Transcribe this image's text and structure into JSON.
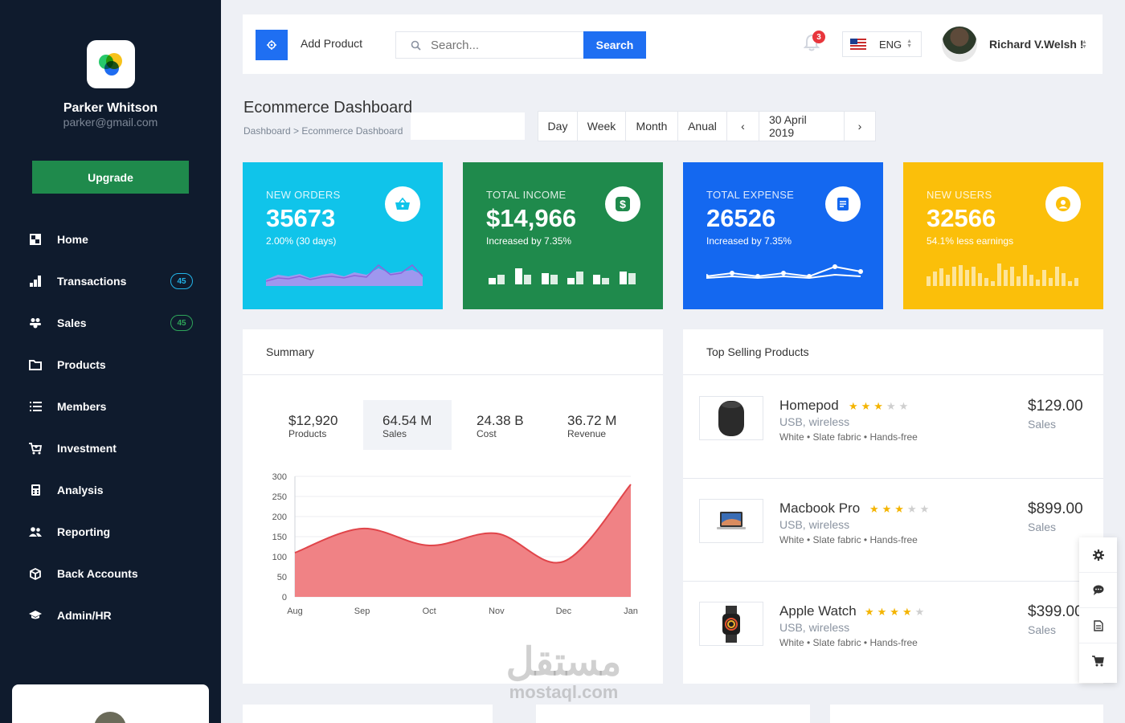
{
  "sidebar": {
    "user_name": "Parker Whitson",
    "user_email": "parker@gmail.com",
    "upgrade_label": "Upgrade",
    "items": [
      {
        "label": "Home",
        "icon": "home-icon"
      },
      {
        "label": "Transactions",
        "icon": "bar-chart-icon",
        "badge": "45"
      },
      {
        "label": "Sales",
        "icon": "users-icon",
        "badge": "45"
      },
      {
        "label": "Products",
        "icon": "folder-icon"
      },
      {
        "label": "Members",
        "icon": "list-icon"
      },
      {
        "label": "Investment",
        "icon": "cart-icon"
      },
      {
        "label": "Analysis",
        "icon": "calculator-icon"
      },
      {
        "label": "Reporting",
        "icon": "people-icon"
      },
      {
        "label": "Back Accounts",
        "icon": "cube-icon"
      },
      {
        "label": "Admin/HR",
        "icon": "graduation-icon"
      }
    ]
  },
  "topbar": {
    "add_label": "Add Product",
    "search_placeholder": "Search...",
    "search_button": "Search",
    "notification_count": "3",
    "language": "ENG",
    "profile_name": "Richard V.Welsh !"
  },
  "header": {
    "title": "Ecommerce Dashboard",
    "breadcrumb": "Dashboard > Ecommerce Dashboard",
    "ranges": [
      "Day",
      "Week",
      "Month",
      "Anual"
    ],
    "prev": "‹",
    "date": "30 April 2019",
    "next": "›"
  },
  "stats": [
    {
      "title": "NEW ORDERS",
      "value": "35673",
      "sub": "2.00% (30 days)",
      "color": "#10c4ea"
    },
    {
      "title": "TOTAL INCOME",
      "value": "$14,966",
      "sub": "Increased by 7.35%",
      "color": "#1f8a4c"
    },
    {
      "title": "TOTAL EXPENSE",
      "value": "26526",
      "sub": "Increased by 7.35%",
      "color": "#1468f0"
    },
    {
      "title": "NEW USERS",
      "value": "32566",
      "sub": "54.1% less earnings",
      "color": "#fbbf0a"
    }
  ],
  "summary": {
    "title": "Summary",
    "metrics": [
      {
        "value": "$12,920",
        "label": "Products"
      },
      {
        "value": "64.54 M",
        "label": "Sales"
      },
      {
        "value": "24.38 B",
        "label": "Cost"
      },
      {
        "value": "36.72 M",
        "label": "Revenue"
      }
    ]
  },
  "chart_data": {
    "type": "area",
    "categories": [
      "Aug",
      "Sep",
      "Oct",
      "Nov",
      "Dec",
      "Jan"
    ],
    "values": [
      110,
      170,
      128,
      158,
      88,
      280
    ],
    "ylim": [
      0,
      300
    ],
    "yticks": [
      0,
      50,
      100,
      150,
      200,
      250,
      300
    ],
    "color": "#ef7b7e",
    "grid": true
  },
  "top_selling": {
    "title": "Top Selling Products",
    "products": [
      {
        "name": "Homepod",
        "desc": "USB, wireless",
        "tags": "White • Slate fabric • Hands-free",
        "price": "$129.00",
        "price_label": "Sales",
        "rating": 3
      },
      {
        "name": "Macbook Pro",
        "desc": "USB, wireless",
        "tags": "White • Slate fabric • Hands-free",
        "price": "$899.00",
        "price_label": "Sales",
        "rating": 3
      },
      {
        "name": "Apple Watch",
        "desc": "USB, wireless",
        "tags": "White • Slate fabric • Hands-free",
        "price": "$399.00",
        "price_label": "Sales",
        "rating": 4
      }
    ]
  },
  "floating_tools": [
    "gear-icon",
    "chat-icon",
    "document-icon",
    "cart-icon"
  ],
  "watermark": {
    "arabic": "مستقل",
    "latin": "mostaql.com"
  }
}
